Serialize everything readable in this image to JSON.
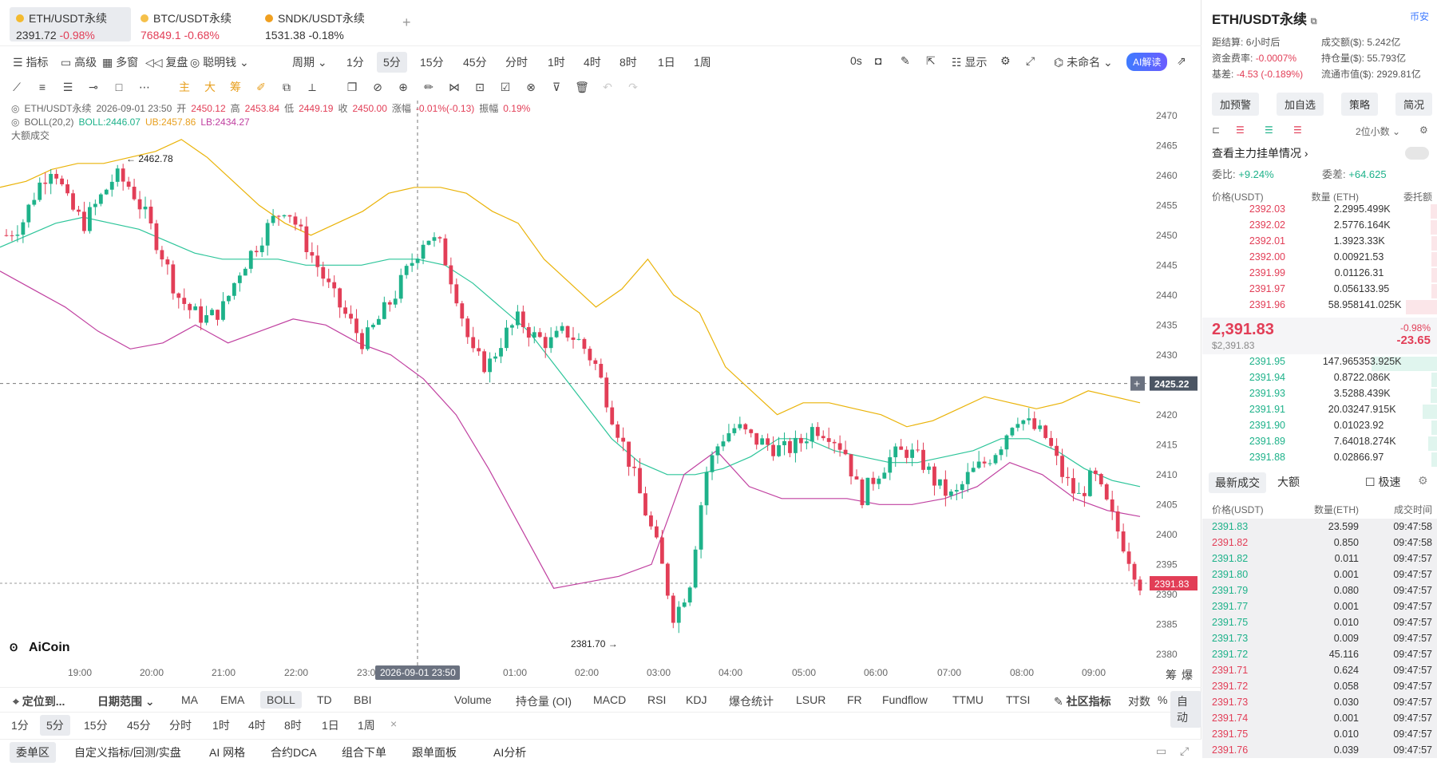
{
  "tabs": [
    {
      "label": "ETH/USDT永续",
      "price": "2391.72",
      "change": "-0.98%",
      "active": true
    },
    {
      "label": "BTC/USDT永续",
      "price": "76849.1",
      "change": "-0.68%",
      "active": false
    },
    {
      "label": "SNDK/USDT永续",
      "price": "1531.38",
      "change": "-0.18%",
      "active": false
    }
  ],
  "toolbar": {
    "indicators": "指标",
    "advanced": "高级",
    "multi": "多窗",
    "replay": "复盘",
    "smart": "聪明钱",
    "period": "周期",
    "intervals": [
      "1分",
      "5分",
      "15分",
      "45分",
      "分时",
      "1时",
      "4时",
      "8时",
      "1日",
      "1周"
    ],
    "selected_interval": "5分",
    "countdown": "0s",
    "display": "显示",
    "unnamed": "未命名",
    "ai": "AI解读"
  },
  "drawtools": {
    "main": "主",
    "big": "大",
    "chip": "筹"
  },
  "chart_info": {
    "symbol": "ETH/USDT永续",
    "time": "2026-09-01 23:50",
    "open_label": "开",
    "open": "2450.12",
    "high_label": "高",
    "high": "2453.84",
    "low_label": "低",
    "low": "2449.19",
    "close_label": "收",
    "close": "2450.00",
    "chg_label": "涨幅",
    "chg": "-0.01%(-0.13)",
    "amp_label": "振幅",
    "amp": "0.19%",
    "boll_label": "BOLL(20,2)",
    "boll": "BOLL:2446.07",
    "ub": "UB:2457.86",
    "lb": "LB:2434.27",
    "big_volume": "大额成交"
  },
  "chart_data": {
    "type": "candlestick",
    "title": "ETH/USDT永续 5分",
    "y_ticks": [
      2470,
      2465,
      2460,
      2455,
      2450,
      2445,
      2440,
      2435,
      2430,
      2425,
      2420,
      2415,
      2410,
      2405,
      2400,
      2395,
      2390,
      2385,
      2380
    ],
    "x_ticks": [
      "19:00",
      "20:00",
      "21:00",
      "22:00",
      "23:00",
      "2026-09-01 23:50",
      "01:00",
      "02:00",
      "03:00",
      "04:00",
      "05:00",
      "06:00",
      "07:00",
      "08:00",
      "09:00"
    ],
    "ylim": [
      2378.5,
      2472.5
    ],
    "crosshair_price": "2425.22",
    "last_price": "2391.83",
    "annotations": [
      {
        "label": "← 2462.78",
        "value": 2462.78
      },
      {
        "label": "2381.70 →",
        "value": 2381.7
      }
    ],
    "close_path": [
      2450,
      2452,
      2458,
      2462,
      2455,
      2452,
      2456,
      2460,
      2458,
      2453,
      2447,
      2440,
      2437,
      2436,
      2438,
      2444,
      2448,
      2452,
      2455,
      2450,
      2445,
      2440,
      2436,
      2432,
      2436,
      2440,
      2445,
      2450,
      2448,
      2440,
      2430,
      2428,
      2433,
      2436,
      2433,
      2432,
      2434,
      2432,
      2428,
      2420,
      2413,
      2405,
      2397,
      2386,
      2392,
      2410,
      2416,
      2418,
      2416,
      2415,
      2414,
      2415,
      2418,
      2417,
      2414,
      2406,
      2410,
      2413,
      2414,
      2412,
      2408,
      2406,
      2410,
      2412,
      2415,
      2420,
      2418,
      2416,
      2410,
      2406,
      2410,
      2404,
      2398,
      2391.83
    ],
    "ub_path": [
      2458,
      2459,
      2461,
      2462,
      2462,
      2463,
      2464,
      2466,
      2463,
      2459,
      2455,
      2452,
      2450,
      2452,
      2454,
      2457,
      2458,
      2458,
      2457,
      2454,
      2452,
      2446,
      2442,
      2438,
      2441,
      2446,
      2440,
      2437,
      2428,
      2424,
      2420,
      2422,
      2422,
      2421,
      2420,
      2418,
      2419,
      2421,
      2423,
      2422,
      2421,
      2422,
      2424,
      2423,
      2422
    ],
    "mid_path": [
      2448,
      2450,
      2452,
      2453,
      2452,
      2451,
      2449,
      2447,
      2446,
      2446,
      2446,
      2445,
      2445,
      2445,
      2446,
      2446,
      2445,
      2442,
      2438,
      2434,
      2428,
      2422,
      2416,
      2412,
      2410,
      2410,
      2411,
      2413,
      2416,
      2416,
      2414,
      2413,
      2412,
      2412,
      2413,
      2414,
      2416,
      2416,
      2414,
      2411,
      2409,
      2408
    ],
    "lb_path": [
      2444,
      2441,
      2438,
      2434,
      2431,
      2432,
      2435,
      2432,
      2434,
      2436,
      2435,
      2432,
      2430,
      2426,
      2420,
      2411,
      2401,
      2391,
      2392,
      2393,
      2395,
      2410,
      2414,
      2408,
      2406,
      2406,
      2406,
      2405,
      2405,
      2406,
      2408,
      2412,
      2410,
      2406,
      2404,
      2403
    ]
  },
  "bottom_indicators": {
    "locate": "定位到...",
    "date_range": "日期范围",
    "items": [
      "MA",
      "EMA",
      "BOLL",
      "TD",
      "BBI",
      "Volume",
      "持仓量 (OI)",
      "MACD",
      "RSI",
      "KDJ",
      "爆仓统计",
      "LSUR",
      "FR",
      "Fundflow",
      "TTMU",
      "TTSI"
    ],
    "selected": "BOLL",
    "community": "社区指标",
    "log": "对数",
    "pct": "%",
    "auto": "自动"
  },
  "bottom_intervals": [
    "1分",
    "5分",
    "15分",
    "45分",
    "分时",
    "1时",
    "4时",
    "8时",
    "1日",
    "1周"
  ],
  "bottom_tabs": [
    "委单区",
    "自定义指标/回测/实盘",
    "AI 网格",
    "合约DCA",
    "组合下单",
    "跟单面板",
    "AI分析"
  ],
  "brand": "AiCoin",
  "corner_labels": [
    "筹",
    "爆"
  ],
  "right": {
    "title": "ETH/USDT永续",
    "exchange": "币安",
    "stats": [
      [
        "距结算:",
        "6小时后",
        "成交额($):",
        "5.242亿"
      ],
      [
        "资金费率:",
        "-0.0007%",
        "持仓量($):",
        "55.793亿"
      ],
      [
        "基差:",
        "-4.53 (-0.189%)",
        "流通市值($):",
        "2929.81亿"
      ]
    ],
    "buttons": [
      "加预警",
      "加自选",
      "策略",
      "简况"
    ],
    "decimals": "2位小数",
    "main_orders": "查看主力挂单情况",
    "ratio_label": "委比:",
    "ratio": "+9.24%",
    "diff_label": "委差:",
    "diff": "+64.625",
    "book_header": [
      "价格(USDT)",
      "数量 (ETH)",
      "委托额"
    ],
    "asks": [
      [
        "2392.03",
        "2.299",
        "5.499K"
      ],
      [
        "2392.02",
        "2.577",
        "6.164K"
      ],
      [
        "2392.01",
        "1.392",
        "3.33K"
      ],
      [
        "2392.00",
        "0.009",
        "21.53"
      ],
      [
        "2391.99",
        "0.011",
        "26.31"
      ],
      [
        "2391.97",
        "0.056",
        "133.95"
      ],
      [
        "2391.96",
        "58.958",
        "141.025K"
      ]
    ],
    "mid_price": "2,391.83",
    "mid_sub": "$2,391.83",
    "mid_pct": "-0.98%",
    "mid_chg": "-23.65",
    "bids": [
      [
        "2391.95",
        "147.965",
        "353.925K"
      ],
      [
        "2391.94",
        "0.872",
        "2.086K"
      ],
      [
        "2391.93",
        "3.528",
        "8.439K"
      ],
      [
        "2391.91",
        "20.032",
        "47.915K"
      ],
      [
        "2391.90",
        "0.010",
        "23.92"
      ],
      [
        "2391.89",
        "7.640",
        "18.274K"
      ],
      [
        "2391.88",
        "0.028",
        "66.97"
      ]
    ],
    "trade_tabs": [
      "最新成交",
      "大额",
      "极速"
    ],
    "trade_header": [
      "价格(USDT)",
      "数量(ETH)",
      "成交时间"
    ],
    "trades": [
      [
        "2391.83",
        "23.599",
        "09:47:58",
        "g"
      ],
      [
        "2391.82",
        "0.850",
        "09:47:58",
        "r"
      ],
      [
        "2391.82",
        "0.011",
        "09:47:57",
        "g"
      ],
      [
        "2391.80",
        "0.001",
        "09:47:57",
        "g"
      ],
      [
        "2391.79",
        "0.080",
        "09:47:57",
        "g"
      ],
      [
        "2391.77",
        "0.001",
        "09:47:57",
        "g"
      ],
      [
        "2391.75",
        "0.010",
        "09:47:57",
        "g"
      ],
      [
        "2391.73",
        "0.009",
        "09:47:57",
        "g"
      ],
      [
        "2391.72",
        "45.116",
        "09:47:57",
        "g"
      ],
      [
        "2391.71",
        "0.624",
        "09:47:57",
        "r"
      ],
      [
        "2391.72",
        "0.058",
        "09:47:57",
        "r"
      ],
      [
        "2391.73",
        "0.030",
        "09:47:57",
        "r"
      ],
      [
        "2391.74",
        "0.001",
        "09:47:57",
        "r"
      ],
      [
        "2391.75",
        "0.010",
        "09:47:57",
        "r"
      ],
      [
        "2391.76",
        "0.039",
        "09:47:57",
        "r"
      ]
    ]
  }
}
